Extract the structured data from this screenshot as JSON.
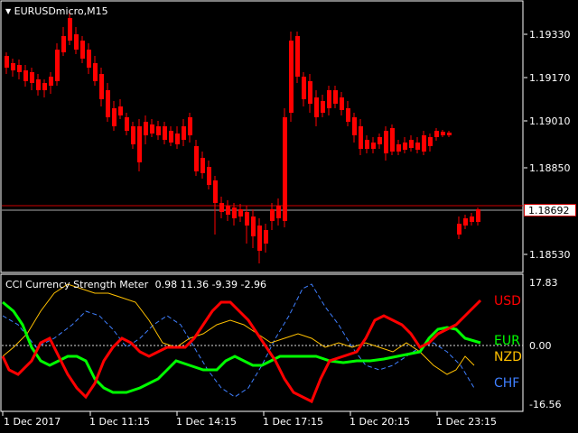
{
  "main_chart": {
    "symbol_label": "EURUSDmicro,M15",
    "price_levels": [
      "1.19330",
      "1.19170",
      "1.19010",
      "1.18850",
      "1.18530"
    ],
    "current_price": "1.18692",
    "colors": {
      "bull": "#00ff00",
      "bear": "#ff0000",
      "grid": "#ffffff",
      "current_line": "#ff0000"
    }
  },
  "indicator": {
    "title": "CCI Currency Strength Meter",
    "values_text": "0.98 11.36 -9.39 -2.96",
    "scale_levels": [
      "17.83",
      "0.00",
      "-16.56"
    ],
    "currencies": [
      {
        "label": "USD",
        "color": "#ff0000"
      },
      {
        "label": "EUR",
        "color": "#00ff00"
      },
      {
        "label": "NZD",
        "color": "#ffc000"
      },
      {
        "label": "CHF",
        "color": "#3f7fff"
      }
    ]
  },
  "time_axis": [
    "1 Dec 2017",
    "1 Dec 11:15",
    "1 Dec 14:15",
    "1 Dec 17:15",
    "1 Dec 20:15",
    "1 Dec 23:15"
  ]
}
